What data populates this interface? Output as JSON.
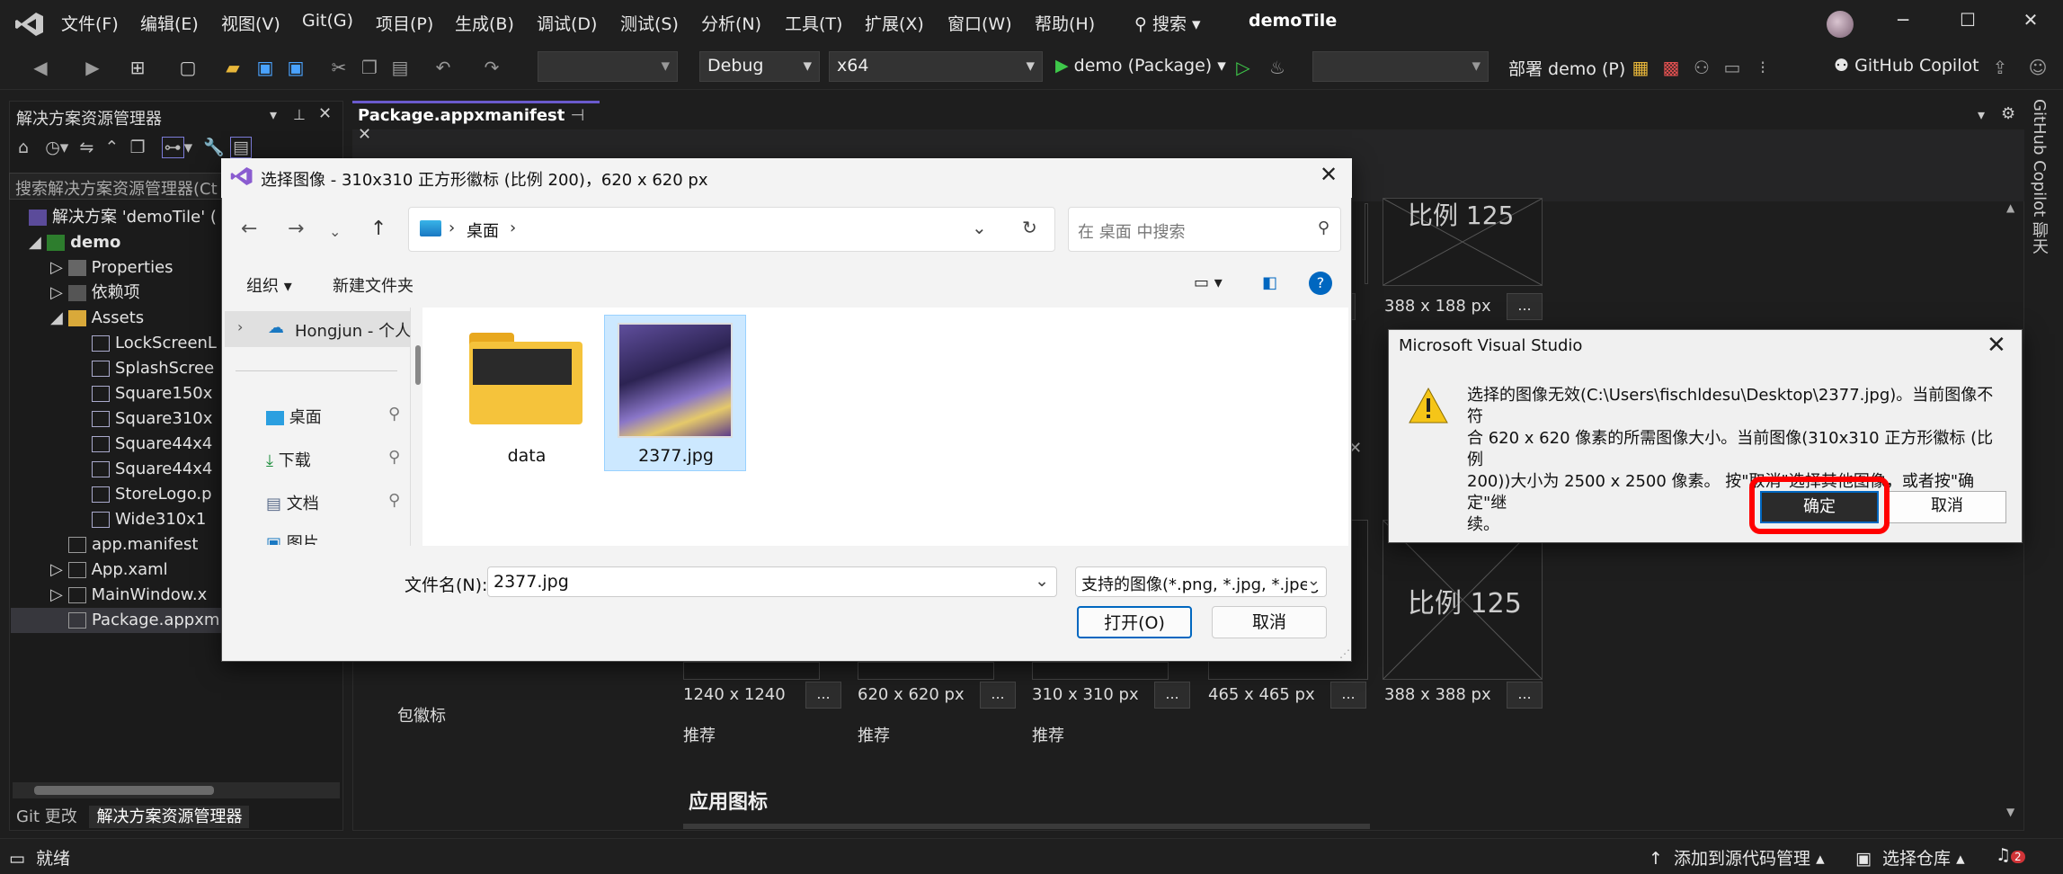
{
  "menubar": {
    "items": [
      "文件(F)",
      "编辑(E)",
      "视图(V)",
      "Git(G)",
      "项目(P)",
      "生成(B)",
      "调试(D)",
      "测试(S)",
      "分析(N)",
      "工具(T)",
      "扩展(X)",
      "窗口(W)",
      "帮助(H)"
    ],
    "search_label": "搜索",
    "app_title": "demoTile"
  },
  "toolbar": {
    "config": "Debug",
    "platform": "x64",
    "run_label": "demo (Package)",
    "deploy_label": "部署 demo (P)",
    "copilot_label": "GitHub Copilot"
  },
  "solution_explorer": {
    "title": "解决方案资源管理器",
    "search_placeholder": "搜索解决方案资源管理器(Ct",
    "solution_label": "解决方案 'demoTile' (",
    "project": "demo",
    "nodes": [
      "Properties",
      "依赖项",
      "Assets",
      "LockScreenL",
      "SplashScree",
      "Square150x",
      "Square310x",
      "Square44x4",
      "Square44x4",
      "StoreLogo.p",
      "Wide310x1",
      "app.manifest",
      "App.xaml",
      "MainWindow.x",
      "Package.appxm"
    ],
    "tabs": [
      "Git 更改",
      "解决方案资源管理器"
    ]
  },
  "editor": {
    "tab_label": "Package.appxmanifest",
    "tiles_top": [
      {
        "scale": "比例 125",
        "size": "388 x 188 px"
      }
    ],
    "tiles_mid_scale": "比例 125",
    "badge_sizes": [
      "1240 x 1240",
      "620 x 620 px",
      "310 x 310 px",
      "465 x 465 px",
      "388 x 388 px"
    ],
    "recommend": [
      "推荐",
      "推荐",
      "推荐"
    ],
    "badge_row_label": "包徽标",
    "section_app_icon": "应用图标",
    "ellipsis": "..."
  },
  "rail": {
    "copilot_chat": "GitHub Copilot 聊天"
  },
  "status": {
    "ready": "就绪",
    "add_source": "添加到源代码管理",
    "select_repo": "选择仓库",
    "notif_count": "2"
  },
  "file_dialog": {
    "title": "选择图像 - 310x310 正方形徽标 (比例 200)，620 x 620 px",
    "breadcrumb": "桌面",
    "search_placeholder": "在 桌面 中搜索",
    "cmd_organize": "组织",
    "cmd_new_folder": "新建文件夹",
    "onedrive_label": "Hongjun - 个人",
    "quick_access": [
      "桌面",
      "下载",
      "文档",
      "图片"
    ],
    "files": [
      {
        "name": "data",
        "icon": "folder-icon"
      },
      {
        "name": "2377.jpg",
        "icon": "image-thumbnail"
      }
    ],
    "filename_label": "文件名(N):",
    "filename_value": "2377.jpg",
    "filter_value": "支持的图像(*.png, *.jpg, *.jpeg",
    "open_label": "打开(O)",
    "cancel_label": "取消"
  },
  "message_box": {
    "title": "Microsoft Visual Studio",
    "line1": "选择的图像无效(C:\\Users\\fischldesu\\Desktop\\2377.jpg)。当前图像不符",
    "line2": "合 620 x 620 像素的所需图像大小。当前图像(310x310 正方形徽标 (比例",
    "line3": "200))大小为 2500 x 2500 像素。 按\"取消\"选择其他图像，或者按\"确定\"继",
    "line4": "续。",
    "ok_label": "确定",
    "cancel_label": "取消"
  }
}
